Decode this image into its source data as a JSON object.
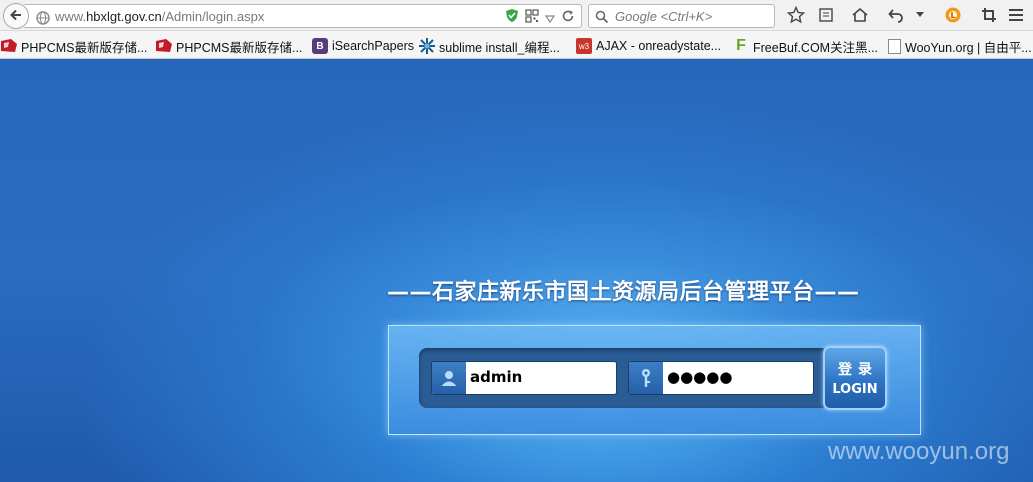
{
  "browser": {
    "url_prefix": "www.",
    "url_host": "hbxlgt.gov.cn",
    "url_path": "/Admin/login.aspx",
    "search_placeholder": "Google <Ctrl+K>",
    "bookmarks": [
      {
        "label": "PHPCMS最新版存储...",
        "icon": "phpcms-favicon"
      },
      {
        "label": "PHPCMS最新版存储...",
        "icon": "phpcms-favicon"
      },
      {
        "label": "iSearchPapers",
        "icon": "bootstrap-favicon"
      },
      {
        "label": "sublime install_编程...",
        "icon": "sublime-favicon"
      },
      {
        "label": "AJAX - onreadystate...",
        "icon": "w3-favicon"
      },
      {
        "label": "FreeBuf.COM关注黑...",
        "icon": "freebuf-favicon"
      },
      {
        "label": "WooYun.org | 自由平...",
        "icon": "blank-page-favicon"
      }
    ],
    "favicon_letters": {
      "bootstrap": "B",
      "w3": "w3",
      "freebuf": "F"
    }
  },
  "page": {
    "title": "——石家庄新乐市国土资源局后台管理平台——",
    "username_value": "admin",
    "password_value": "●●●●●",
    "login_label_cn": "登录",
    "login_label_en": "LOGIN",
    "watermark": "www.wooyun.org"
  },
  "colors": {
    "page_bg": "#2767bb",
    "accent": "#4aa8ec"
  }
}
